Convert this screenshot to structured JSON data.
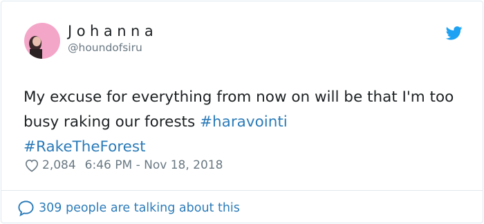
{
  "tweet": {
    "author": {
      "display_name": "Johanna",
      "handle": "@houndofsiru"
    },
    "text_plain": "My excuse for everything from now on will be that I'm too busy raking our forests ",
    "hashtags": [
      "#haravointi",
      "#RakeTheForest"
    ],
    "likes": "2,084",
    "timestamp": "6:46 PM - Nov 18, 2018",
    "talking_label": "309 people are talking about this"
  },
  "icons": {
    "brand": "twitter-bird-icon",
    "like": "heart-icon",
    "reply": "speech-bubble-icon"
  },
  "colors": {
    "link": "#2b7bb9",
    "brand": "#1da1f2",
    "muted": "#697882",
    "text": "#1c2022",
    "avatar_bg": "#f4a6c9"
  }
}
